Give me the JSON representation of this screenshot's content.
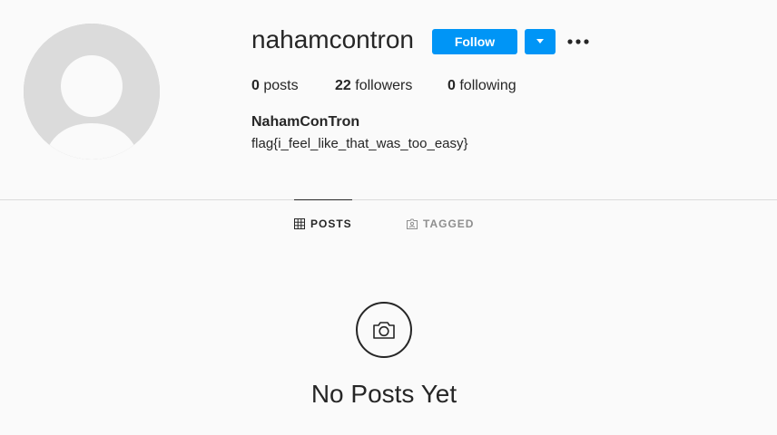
{
  "profile": {
    "username": "nahamcontron",
    "full_name": "NahamConTron",
    "bio": "flag{i_feel_like_that_was_too_easy}",
    "avatar_icon": "default-avatar-icon"
  },
  "actions": {
    "follow_label": "Follow",
    "dropdown_icon": "caret-down-icon",
    "more_icon": "more-options-icon"
  },
  "stats": {
    "posts_count": "0",
    "posts_label": "posts",
    "followers_count": "22",
    "followers_label": "followers",
    "following_count": "0",
    "following_label": "following"
  },
  "tabs": [
    {
      "label": "POSTS",
      "icon": "grid-icon",
      "active": true
    },
    {
      "label": "TAGGED",
      "icon": "tagged-icon",
      "active": false
    }
  ],
  "empty_state": {
    "icon": "camera-icon",
    "title": "No Posts Yet"
  },
  "colors": {
    "accent": "#0095f6",
    "background": "#fafafa",
    "text": "#262626",
    "muted": "#8e8e8e",
    "border": "#dbdbdb"
  }
}
